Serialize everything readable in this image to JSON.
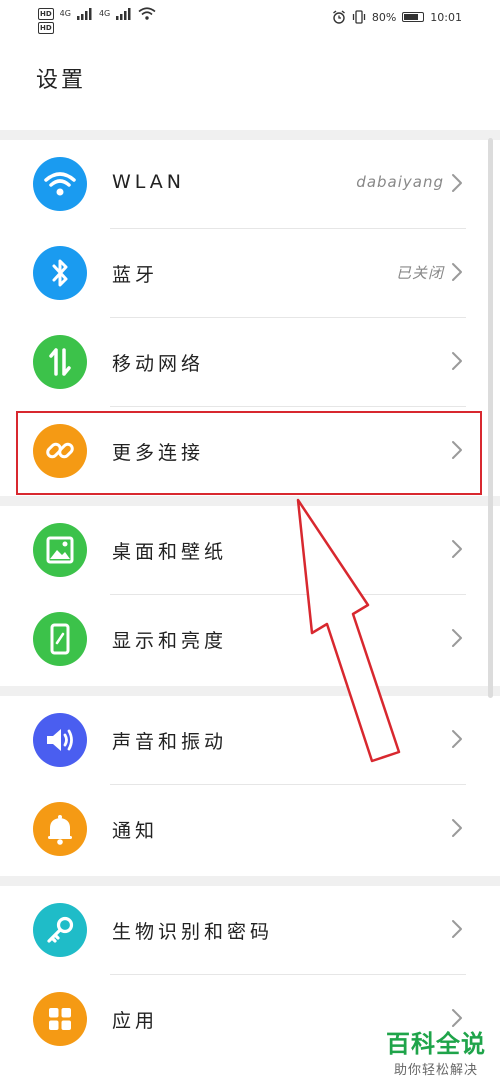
{
  "status_bar": {
    "sim1": "HD",
    "sim2": "HD",
    "network1": "4G",
    "network2": "4G",
    "battery_text": "80%",
    "battery_level": 0.8,
    "time": "10:01"
  },
  "page": {
    "title": "设置"
  },
  "groups": [
    {
      "items": [
        {
          "label": "WLAN",
          "value": "dabaiyang",
          "icon": "wifi-icon",
          "color": "#1a9bf0"
        },
        {
          "label": "蓝牙",
          "value": "已关闭",
          "icon": "bluetooth-icon",
          "color": "#1a9bf0"
        },
        {
          "label": "移动网络",
          "value": "",
          "icon": "mobile-data-icon",
          "color": "#3cc24a"
        },
        {
          "label": "更多连接",
          "value": "",
          "icon": "link-icon",
          "color": "#f59a14"
        }
      ]
    },
    {
      "items": [
        {
          "label": "桌面和壁纸",
          "value": "",
          "icon": "wallpaper-icon",
          "color": "#3cc24a"
        },
        {
          "label": "显示和亮度",
          "value": "",
          "icon": "display-icon",
          "color": "#3cc24a"
        }
      ]
    },
    {
      "items": [
        {
          "label": "声音和振动",
          "value": "",
          "icon": "volume-icon",
          "color": "#4a5ef0"
        },
        {
          "label": "通知",
          "value": "",
          "icon": "bell-icon",
          "color": "#f59a14"
        }
      ]
    },
    {
      "items": [
        {
          "label": "生物识别和密码",
          "value": "",
          "icon": "key-icon",
          "color": "#1fbcc8"
        },
        {
          "label": "应用",
          "value": "",
          "icon": "apps-icon",
          "color": "#f59a14"
        }
      ]
    }
  ],
  "watermark": {
    "title": "百科全说",
    "subtitle": "助你轻松解决"
  },
  "colors": {
    "annotation_red": "#d8282f",
    "watermark_green": "#1fa44a"
  }
}
